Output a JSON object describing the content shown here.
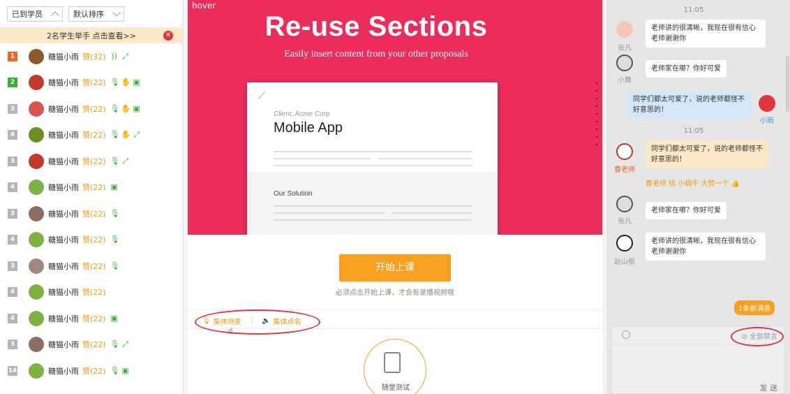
{
  "left": {
    "filter_attendance": "已到学员",
    "filter_sort": "默认排序",
    "raise_hands_text": "2名学生举手  点击查看>>",
    "close_symbol": "✕",
    "students": [
      {
        "rank": "1",
        "name": "糖猫小雨",
        "zan": "赞(32)",
        "icons": [
          "))",
          "⤢"
        ]
      },
      {
        "rank": "2",
        "name": "糖猫小雨",
        "zan": "赞(22)",
        "icons": [
          "🎙",
          "✋",
          "▣"
        ]
      },
      {
        "rank": "3",
        "name": "糖猫小雨",
        "zan": "赞(22)",
        "icons": [
          "🎙",
          "✋",
          "▣"
        ]
      },
      {
        "rank": "4",
        "name": "糖猫小雨",
        "zan": "赞(22)",
        "icons": [
          "🎙",
          "✋",
          "⤢"
        ]
      },
      {
        "rank": "3",
        "name": "糖猫小雨",
        "zan": "赞(22)",
        "icons": [
          "🎙",
          "⤢"
        ]
      },
      {
        "rank": "4",
        "name": "糖猫小雨",
        "zan": "赞(22)",
        "icons": [
          "▣"
        ]
      },
      {
        "rank": "3",
        "name": "糖猫小雨",
        "zan": "赞(22)",
        "icons": [
          "🎙"
        ]
      },
      {
        "rank": "4",
        "name": "糖猫小雨",
        "zan": "赞(22)",
        "icons": [
          "🎙"
        ]
      },
      {
        "rank": "3",
        "name": "糖猫小雨",
        "zan": "赞(22)",
        "icons": [
          "🎙"
        ]
      },
      {
        "rank": "4",
        "name": "糖猫小雨",
        "zan": "赞(22)",
        "icons": []
      },
      {
        "rank": "4",
        "name": "糖猫小雨",
        "zan": "赞(22)",
        "icons": [
          "▣"
        ]
      },
      {
        "rank": "3",
        "name": "糖猫小雨",
        "zan": "赞(22)",
        "icons": [
          "🎙",
          "⤢"
        ]
      },
      {
        "rank": "14",
        "name": "糖猫小雨",
        "zan": "赞(22)",
        "icons": [
          "🎙",
          "▣"
        ]
      }
    ]
  },
  "center": {
    "hover_label": "hover",
    "banner_title": "Re-use Sections",
    "banner_subtitle": "Easily insert content from your other proposals",
    "doc_client": "Client: Acme Corp",
    "doc_title": "Mobile App",
    "doc_solution": "Our Solution",
    "start_button": "开始上课",
    "start_hint": "必须点击开始上课，才会有录播视频哦",
    "tool_mic_test": "集体测麦",
    "tool_roll_call": "集体点名",
    "quiz_label": "随堂测试"
  },
  "chat": {
    "time1": "11:05",
    "time2": "11:05",
    "messages": [
      {
        "name": "张凡",
        "text": "老师讲的很清晰，我现在很有信心老师谢谢你"
      },
      {
        "name": "小舞",
        "text": "老师家在哪？你好可爱"
      },
      {
        "name": "小雨",
        "text": "同学们都太可爱了，说的老师都怪不好意思的！"
      },
      {
        "name": "曹老师",
        "text": "同学们都太可爱了，说的老师都怪不好意思的！"
      },
      {
        "name": "张凡",
        "text": "老师家在哪？你好可爱"
      },
      {
        "name": "赵山根",
        "text": "老师讲的很清晰，我现在很有信心老师谢谢你"
      }
    ],
    "gift_text": "曹老师 给 小蜗牛 大赞一个",
    "new_messages": "1条新消息",
    "mute_all": "⊘ 全部禁言",
    "send": "发 送"
  },
  "colors": {
    "accent": "#f9a020",
    "banner": "#ec2d5c",
    "alert": "#e0353b",
    "green": "#3ab03a"
  }
}
